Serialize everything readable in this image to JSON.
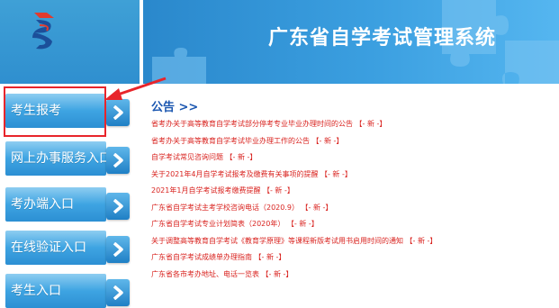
{
  "header": {
    "system_title": "广东省自学考试管理系统"
  },
  "sidebar": {
    "items": [
      {
        "label": "考生报考"
      },
      {
        "label": "网上办事服务入口"
      },
      {
        "label": "考办端入口"
      },
      {
        "label": "在线验证入口"
      },
      {
        "label": "考生入口"
      }
    ]
  },
  "notices": {
    "heading": "公告 >>",
    "new_tag": "【- 新 -】",
    "items": [
      "省考办关于高等教育自学考试部分停考专业毕业办理时间的公告",
      "省考办关于高等教育自学考试毕业办理工作的公告",
      "自学考试常见咨询问题",
      "关于2021年4月自学考试报考及缴费有关事项的提醒",
      "2021年1月自学考试报考缴费提醒",
      "广东省自学考试主考学校咨询电话（2020.9）",
      "广东省自学考试专业计划简表（2020年）",
      "关于调整高等教育自学考试《教育学原理》等课程新版考试用书启用时间的通知",
      "广东省自学考试成绩单办理指南",
      "广东省各市考办地址、电话一览表"
    ]
  },
  "icons": {
    "logo": "exam-authority-logo",
    "menu_arrow": "chevron-right-icon"
  },
  "colors": {
    "header_blue": "#2f8fcf",
    "notice_red": "#d9231f",
    "heading_blue": "#1a56b0",
    "annotation_red": "#e8252b"
  }
}
